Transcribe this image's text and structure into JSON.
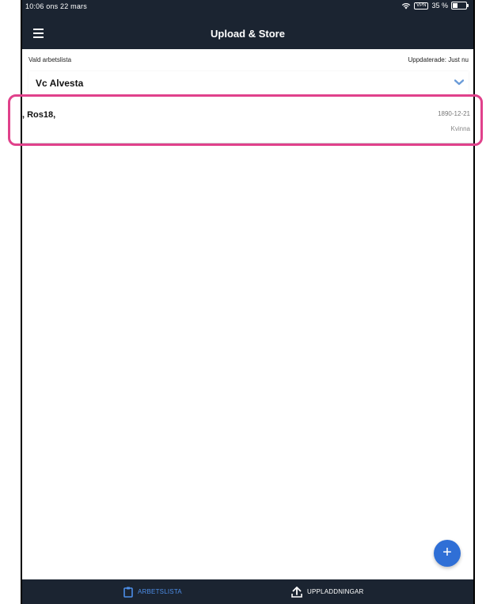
{
  "status_bar": {
    "time_date": "10:06  ons 22 mars",
    "battery_text": "35 %"
  },
  "header": {
    "title": "Upload & Store",
    "menu_icon": "hamburger-menu-icon"
  },
  "worklist": {
    "selected_label": "Vald arbetslista",
    "updated_label": "Uppdaterade: Just nu",
    "selected_value": "Vc Alvesta",
    "dropdown_icon": "chevron-down-icon"
  },
  "patients": [
    {
      "name": ", Ros18,",
      "dob": "1890-12-21",
      "gender": "Kvinna"
    }
  ],
  "fab": {
    "label": "+",
    "icon": "plus-icon"
  },
  "bottom_tabs": {
    "worklist": {
      "label": "ARBETSLISTA",
      "icon": "clipboard-icon",
      "active": true
    },
    "uploads": {
      "label": "UPPLADDNINGAR",
      "icon": "upload-icon",
      "active": false
    }
  },
  "colors": {
    "bar_bg": "#1b2431",
    "accent": "#2f6fd6",
    "highlight": "#e0418b",
    "active_tab": "#4d8ee8"
  }
}
